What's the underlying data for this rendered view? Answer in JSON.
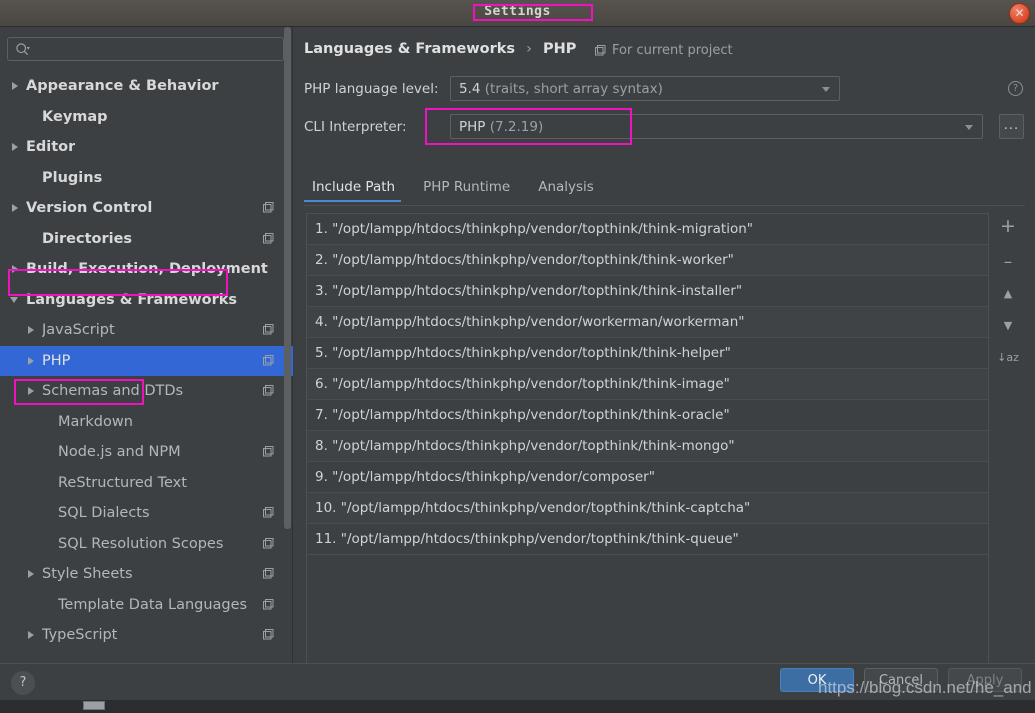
{
  "window": {
    "title": "Settings",
    "close_icon": "close-icon"
  },
  "sidebar": {
    "search": {
      "value": "",
      "placeholder": "",
      "icon": "search-icon"
    },
    "items": [
      {
        "label": "Appearance & Behavior",
        "arrow": "closed",
        "top": true,
        "module": false,
        "indent": 10,
        "selected": false
      },
      {
        "label": "Keymap",
        "arrow": "none",
        "top": true,
        "module": false,
        "indent": 26,
        "selected": false
      },
      {
        "label": "Editor",
        "arrow": "closed",
        "top": true,
        "module": false,
        "indent": 10,
        "selected": false
      },
      {
        "label": "Plugins",
        "arrow": "none",
        "top": true,
        "module": false,
        "indent": 26,
        "selected": false
      },
      {
        "label": "Version Control",
        "arrow": "closed",
        "top": true,
        "module": true,
        "indent": 10,
        "selected": false
      },
      {
        "label": "Directories",
        "arrow": "none",
        "top": true,
        "module": true,
        "indent": 26,
        "selected": false
      },
      {
        "label": "Build, Execution, Deployment",
        "arrow": "closed",
        "top": true,
        "module": false,
        "indent": 10,
        "selected": false
      },
      {
        "label": "Languages & Frameworks",
        "arrow": "open",
        "top": true,
        "module": false,
        "indent": 10,
        "selected": false
      },
      {
        "label": "JavaScript",
        "arrow": "closed",
        "top": false,
        "module": true,
        "indent": 26,
        "selected": false
      },
      {
        "label": "PHP",
        "arrow": "closed",
        "top": false,
        "module": true,
        "indent": 26,
        "selected": true
      },
      {
        "label": "Schemas and DTDs",
        "arrow": "closed",
        "top": false,
        "module": true,
        "indent": 26,
        "selected": false
      },
      {
        "label": "Markdown",
        "arrow": "none",
        "top": false,
        "module": false,
        "indent": 42,
        "selected": false
      },
      {
        "label": "Node.js and NPM",
        "arrow": "none",
        "top": false,
        "module": true,
        "indent": 42,
        "selected": false
      },
      {
        "label": "ReStructured Text",
        "arrow": "none",
        "top": false,
        "module": false,
        "indent": 42,
        "selected": false
      },
      {
        "label": "SQL Dialects",
        "arrow": "none",
        "top": false,
        "module": true,
        "indent": 42,
        "selected": false
      },
      {
        "label": "SQL Resolution Scopes",
        "arrow": "none",
        "top": false,
        "module": true,
        "indent": 42,
        "selected": false
      },
      {
        "label": "Style Sheets",
        "arrow": "closed",
        "top": false,
        "module": true,
        "indent": 26,
        "selected": false
      },
      {
        "label": "Template Data Languages",
        "arrow": "none",
        "top": false,
        "module": true,
        "indent": 42,
        "selected": false
      },
      {
        "label": "TypeScript",
        "arrow": "closed",
        "top": false,
        "module": true,
        "indent": 26,
        "selected": false
      }
    ]
  },
  "main": {
    "breadcrumb": {
      "parent": "Languages & Frameworks",
      "separator": "›",
      "current": "PHP"
    },
    "scope": {
      "label": "For current project",
      "icon": "module-icon"
    },
    "language_level": {
      "label": "PHP language level:",
      "value_main": "5.4 ",
      "value_detail": "(traits, short array syntax)",
      "help_icon": "question-mark-icon"
    },
    "cli_interpreter": {
      "label": "CLI Interpreter:",
      "value_main": "PHP ",
      "value_detail": "(7.2.19)",
      "browse_label": "...",
      "browse_icon": "ellipsis-icon"
    },
    "tabs": [
      {
        "label": "Include Path",
        "active": true
      },
      {
        "label": "PHP Runtime",
        "active": false
      },
      {
        "label": "Analysis",
        "active": false
      }
    ],
    "include_paths": [
      "1. \"/opt/lampp/htdocs/thinkphp/vendor/topthink/think-migration\"",
      "2. \"/opt/lampp/htdocs/thinkphp/vendor/topthink/think-worker\"",
      "3. \"/opt/lampp/htdocs/thinkphp/vendor/topthink/think-installer\"",
      "4. \"/opt/lampp/htdocs/thinkphp/vendor/workerman/workerman\"",
      "5. \"/opt/lampp/htdocs/thinkphp/vendor/topthink/think-helper\"",
      "6. \"/opt/lampp/htdocs/thinkphp/vendor/topthink/think-image\"",
      "7. \"/opt/lampp/htdocs/thinkphp/vendor/topthink/think-oracle\"",
      "8. \"/opt/lampp/htdocs/thinkphp/vendor/topthink/think-mongo\"",
      "9. \"/opt/lampp/htdocs/thinkphp/vendor/composer\"",
      "10. \"/opt/lampp/htdocs/thinkphp/vendor/topthink/think-captcha\"",
      "11. \"/opt/lampp/htdocs/thinkphp/vendor/topthink/think-queue\""
    ],
    "list_tools": [
      {
        "name": "add-icon",
        "glyph": "+"
      },
      {
        "name": "remove-icon",
        "glyph": "–"
      },
      {
        "name": "move-up-icon",
        "glyph": "▲"
      },
      {
        "name": "move-down-icon",
        "glyph": "▼"
      },
      {
        "name": "sort-alphabetical-icon",
        "glyph": "↓az"
      }
    ]
  },
  "footer": {
    "help_label": "?",
    "ok_label": "OK",
    "cancel_label": "Cancel",
    "apply_label": "Apply"
  },
  "watermark": {
    "text": "https://blog.csdn.net/he_and"
  },
  "colors": {
    "background": "#3c4043",
    "selection_blue": "#3367d6",
    "accent_blue": "#4a88d8",
    "annotation_magenta": "#f012be",
    "ok_button": "#3c6da3",
    "text_primary": "#d0d3d5",
    "text_secondary": "#9aa0a6"
  }
}
